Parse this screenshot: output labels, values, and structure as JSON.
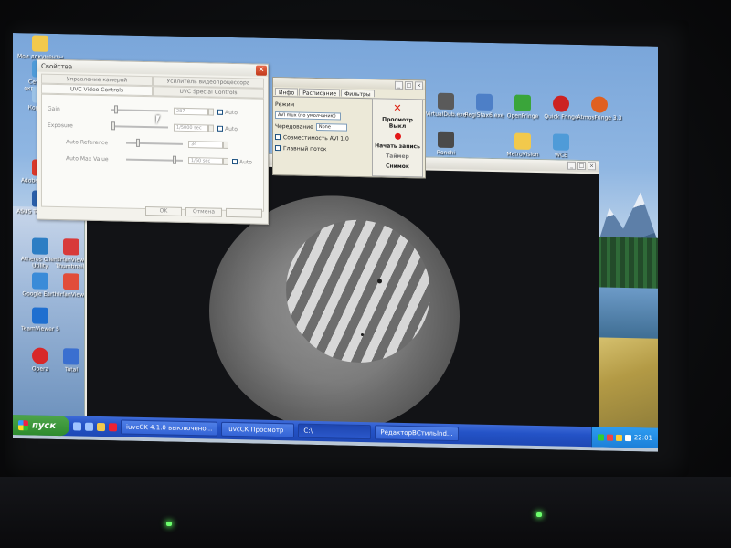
{
  "desktop": {
    "icons_left": [
      {
        "label": "Мои документы",
        "color": "#f2c94c"
      },
      {
        "label": "Сетевое окружение",
        "color": "#4f9bd8"
      },
      {
        "label": "Корзина",
        "color": "#9cc3e6"
      },
      {
        "label": "Adobe Reader",
        "color": "#d8382a"
      },
      {
        "label": "ASUS Technology",
        "color": "#2a5ea8"
      },
      {
        "label": "Atheros Client Utility",
        "color": "#2d7ec4"
      },
      {
        "label": "IrfanView Thumbnails",
        "color": "#d83a3a"
      },
      {
        "label": "Google Earth",
        "color": "#3a8bd8"
      },
      {
        "label": "IrfanView",
        "color": "#e14d3a"
      },
      {
        "label": "TeamViewer 5",
        "color": "#1f6fd0"
      },
      {
        "label": "Opera",
        "color": "#d8282a"
      },
      {
        "label": "Total",
        "color": "#3a6fd0"
      }
    ],
    "icons_top": [
      {
        "label": "VirtualDub.exe",
        "color": "#5a5a5a"
      },
      {
        "label": "RegiStax6.exe",
        "color": "#4d7fc7"
      },
      {
        "label": "OpenFringe",
        "color": "#3aa53a"
      },
      {
        "label": "Quick Fringe",
        "color": "#c22"
      },
      {
        "label": "AtmosFringe 3.3",
        "color": "#e06020"
      },
      {
        "label": "Ronchi",
        "color": "#4a4a4a"
      },
      {
        "label": "MetroVision",
        "color": "#f2c94c"
      },
      {
        "label": "WCE",
        "color": "#4f9bd8"
      }
    ]
  },
  "props_dialog": {
    "title": "Свойства",
    "close_glyph": "✕",
    "tabs_top": [
      "Управление камерой",
      "Усилитель видеопроцессора"
    ],
    "tabs_bottom": [
      "UVC Video Controls",
      "UVC Special Controls"
    ],
    "controls": [
      {
        "label": "Gain",
        "value": "287",
        "auto_label": "Auto",
        "level": 0.05
      },
      {
        "label": "Exposure",
        "value": "1/5000 sec",
        "auto_label": "Auto",
        "level": 0.0
      },
      {
        "label": "Auto Reference",
        "value": "34",
        "auto_label": "",
        "level": 0.2
      },
      {
        "label": "Auto Max Value",
        "value": "1/60 sec",
        "auto_label": "Auto",
        "level": 0.9
      }
    ],
    "ok_label": "OK",
    "cancel_label": "Отмена",
    "apply_label": ""
  },
  "capture_panel": {
    "tabs": [
      "Инфо",
      "Расписание",
      "Фильтры"
    ],
    "mode_label": "Режим",
    "mode_value": "AVI mux (по умолчанию)",
    "interleave_label": "Чередование",
    "interleave_value": "None",
    "avi_compat_label": "Совместимость AVI 1.0",
    "main_stream_label": "Главный поток",
    "side": {
      "preview_label": "Просмотр Выкл",
      "record_label": "Начать запись",
      "timer_label": "Таймер",
      "snapshot_label": "Снимок"
    }
  },
  "taskbar": {
    "start_label": "пуск",
    "tasks": [
      {
        "label": "iuvcCK 4.1.0 выключено..."
      },
      {
        "label": "iuvcCK Просмотр"
      },
      {
        "label": "C:\\"
      },
      {
        "label": "РедакторВСтильInd..."
      }
    ],
    "clock": "22:01"
  }
}
